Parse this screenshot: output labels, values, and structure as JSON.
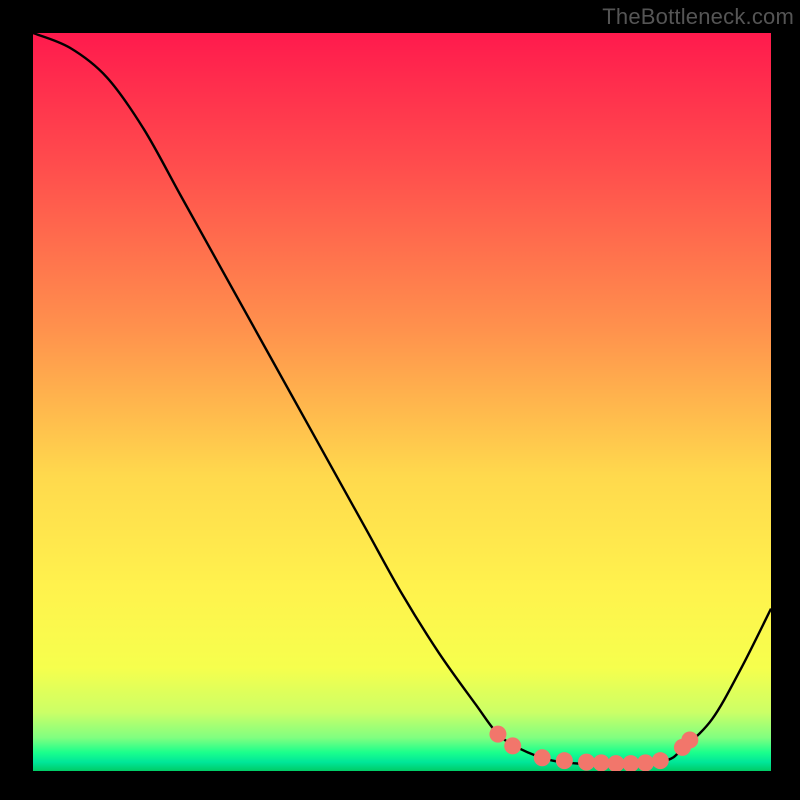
{
  "watermark": {
    "text": "TheBottleneck.com"
  },
  "chart_data": {
    "type": "line",
    "title": "",
    "xlabel": "",
    "ylabel": "",
    "xlim": [
      0,
      100
    ],
    "ylim": [
      0,
      100
    ],
    "x": [
      0,
      5,
      10,
      15,
      20,
      25,
      30,
      35,
      40,
      45,
      50,
      55,
      60,
      63,
      66,
      70,
      74,
      78,
      82,
      86,
      88,
      92,
      96,
      100
    ],
    "values": [
      100,
      98,
      94,
      87,
      78,
      69,
      60,
      51,
      42,
      33,
      24,
      16,
      9,
      5,
      3,
      1.5,
      1,
      1,
      1,
      1.5,
      3,
      7,
      14,
      22
    ],
    "markers": {
      "x": [
        63,
        65,
        69,
        72,
        75,
        77,
        79,
        81,
        83,
        85,
        88,
        89
      ],
      "y": [
        5,
        3.4,
        1.8,
        1.4,
        1.2,
        1.1,
        1.0,
        1.0,
        1.1,
        1.4,
        3.2,
        4.2
      ]
    },
    "gradient_stops": [
      {
        "offset": 0.0,
        "color": "#ff1a4d"
      },
      {
        "offset": 0.18,
        "color": "#ff4d4d"
      },
      {
        "offset": 0.4,
        "color": "#ff914d"
      },
      {
        "offset": 0.6,
        "color": "#ffd94d"
      },
      {
        "offset": 0.75,
        "color": "#fff24d"
      },
      {
        "offset": 0.86,
        "color": "#f6ff4d"
      },
      {
        "offset": 0.92,
        "color": "#ccff66"
      },
      {
        "offset": 0.955,
        "color": "#80ff80"
      },
      {
        "offset": 0.975,
        "color": "#1aff8c"
      },
      {
        "offset": 0.988,
        "color": "#00e699"
      },
      {
        "offset": 1.0,
        "color": "#00cc66"
      }
    ],
    "marker_color": "#f2766b",
    "line_color": "#000000"
  }
}
